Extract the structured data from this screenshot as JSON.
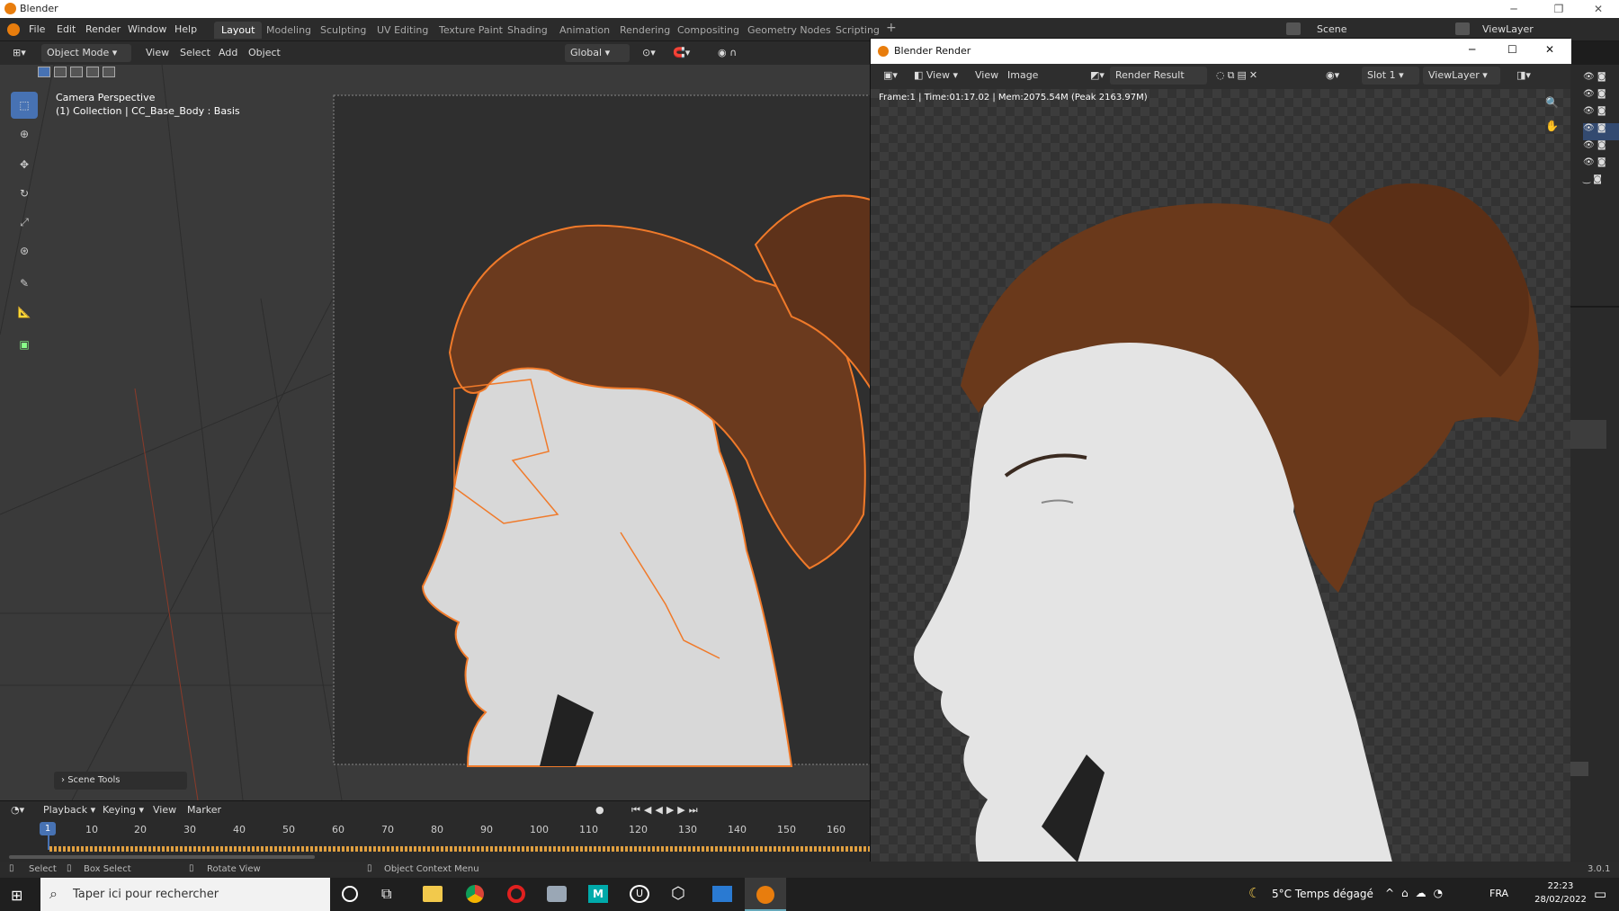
{
  "window": {
    "title": "Blender"
  },
  "menubar": {
    "items": [
      "File",
      "Edit",
      "Render",
      "Window",
      "Help"
    ],
    "workspaces": [
      "Layout",
      "Modeling",
      "Sculpting",
      "UV Editing",
      "Texture Paint",
      "Shading",
      "Animation",
      "Rendering",
      "Compositing",
      "Geometry Nodes",
      "Scripting"
    ],
    "active_workspace": "Layout",
    "scene": "Scene",
    "viewlayer": "ViewLayer"
  },
  "viewport_header": {
    "mode": "Object Mode",
    "menus": [
      "View",
      "Select",
      "Add",
      "Object"
    ],
    "orientation": "Global"
  },
  "viewport": {
    "camera_label": "Camera Perspective",
    "collection_label": "(1) Collection | CC_Base_Body : Basis",
    "scene_tools": "Scene Tools"
  },
  "render_window": {
    "title": "Blender Render",
    "menus": [
      "View",
      "View",
      "Image"
    ],
    "render_result": "Render Result",
    "slot": "Slot 1",
    "viewlayer": "ViewLayer",
    "info": "Frame:1 | Time:01:17.02 | Mem:2075.54M (Peak 2163.97M)"
  },
  "timeline": {
    "menus": [
      "Playback",
      "Keying",
      "View",
      "Marker"
    ],
    "current_frame": "1",
    "ticks": [
      "10",
      "20",
      "30",
      "40",
      "50",
      "60",
      "70",
      "80",
      "90",
      "100",
      "110",
      "120",
      "130",
      "140",
      "150",
      "160"
    ]
  },
  "statusbar": {
    "select": "Select",
    "box_select": "Box Select",
    "rotate_view": "Rotate View",
    "context_menu": "Object Context Menu",
    "version": "3.0.1"
  },
  "taskbar": {
    "search_placeholder": "Taper ici pour rechercher",
    "weather": "5°C  Temps dégagé",
    "lang": "FRA",
    "time": "22:23",
    "date": "28/02/2022"
  },
  "colors": {
    "accent": "#4772b3",
    "selection_outline": "#f07a2a",
    "keyframe": "#e0a040"
  }
}
